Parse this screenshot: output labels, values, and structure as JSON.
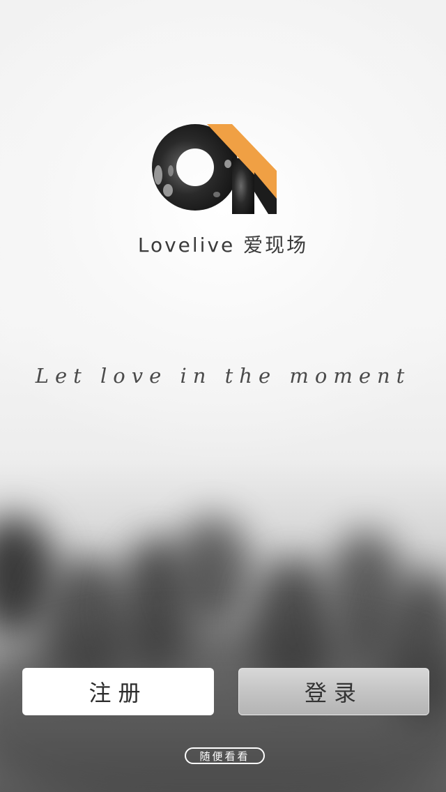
{
  "app": {
    "brand_name": "Lovelive 爱现场",
    "tagline": "Let love in the moment",
    "logo_icon": "lovelive-a-logo-icon",
    "accent_color": "#f0a044"
  },
  "actions": {
    "register_label": "注册",
    "login_label": "登录",
    "browse_label": "随便看看"
  }
}
